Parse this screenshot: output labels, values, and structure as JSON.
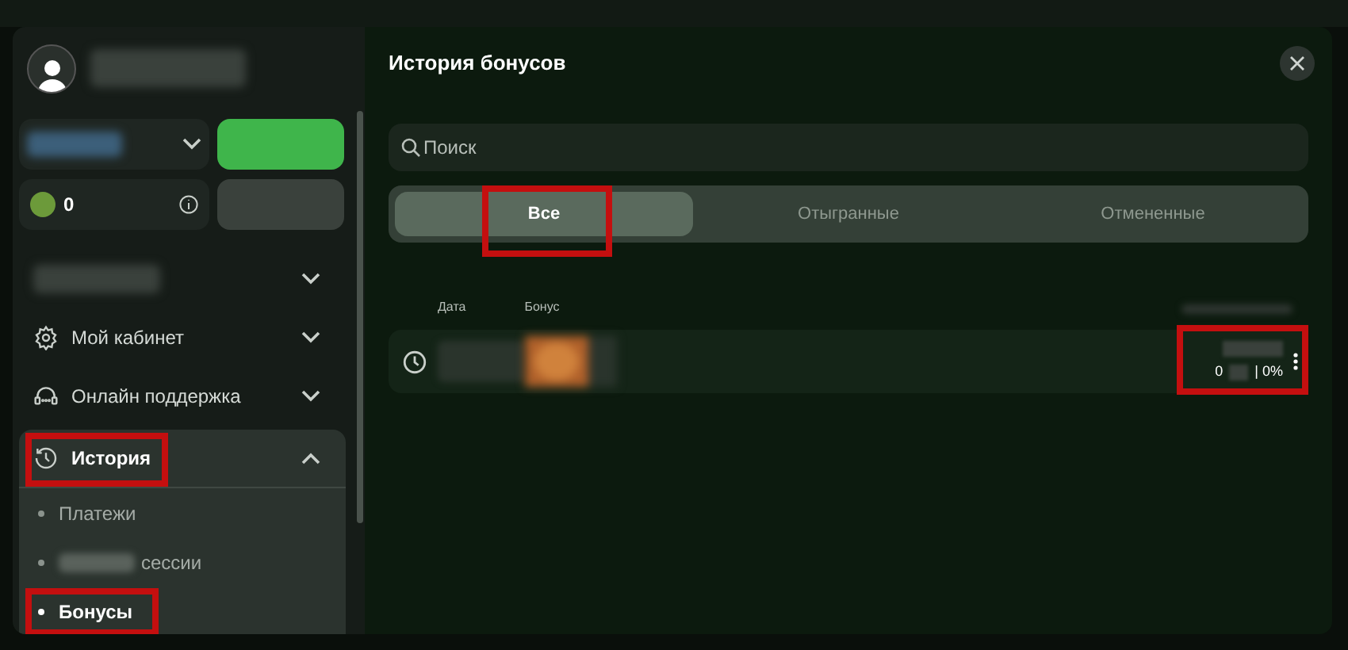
{
  "sidebar": {
    "balance": "0",
    "items": [
      {
        "kind": "redacted",
        "expanded": false
      },
      {
        "kind": "item",
        "label": "Мой кабинет",
        "expanded": false
      },
      {
        "kind": "item",
        "label": "Онлайн поддержка",
        "expanded": false
      },
      {
        "kind": "group",
        "label": "История",
        "expanded": true,
        "highlighted": true,
        "children": [
          {
            "label": "Платежи",
            "selected": false,
            "highlighted": false
          },
          {
            "label": "сессии",
            "redacted_prefix": true,
            "selected": false,
            "highlighted": false
          },
          {
            "label": "Бонусы",
            "selected": true,
            "highlighted": true
          }
        ]
      }
    ]
  },
  "panel": {
    "title": "История бонусов",
    "search": {
      "placeholder": "Поиск"
    },
    "tabs": [
      {
        "label": "Все",
        "selected": true,
        "highlighted": true
      },
      {
        "label": "Отыгранные",
        "selected": false,
        "highlighted": false
      },
      {
        "label": "Отмененные",
        "selected": false,
        "highlighted": false
      }
    ],
    "columns": [
      "Дата",
      "Бонус"
    ],
    "rows": [
      {
        "amount": "0",
        "percent": "| 0%",
        "highlighted": true
      }
    ]
  }
}
